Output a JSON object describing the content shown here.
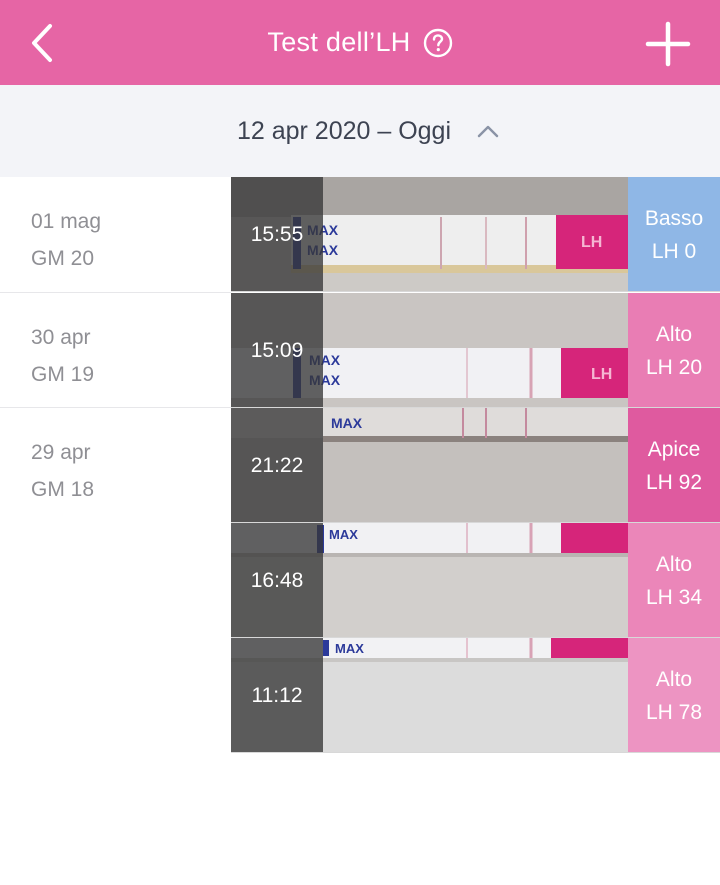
{
  "header": {
    "title": "Test dell’LH",
    "back_icon": "chevron-left-icon",
    "help_icon": "question-circle-icon",
    "add_icon": "plus-icon",
    "color": "#e665a5"
  },
  "range": {
    "label": "12 apr 2020 – Oggi",
    "icon": "chevron-up-icon"
  },
  "days": [
    {
      "date": "01 mag",
      "cycle_day": "GM 20"
    },
    {
      "date": "30 apr",
      "cycle_day": "GM 19"
    },
    {
      "date": "29 apr",
      "cycle_day": "GM 18"
    }
  ],
  "tests": [
    {
      "time": "15:55",
      "level": "Basso",
      "value": "LH 0",
      "color": "#8fb7e6"
    },
    {
      "time": "15:09",
      "level": "Alto",
      "value": "LH 20",
      "color": "#e97db4"
    },
    {
      "time": "21:22",
      "level": "Apice",
      "value": "LH 92",
      "color": "#df5a9f"
    },
    {
      "time": "16:48",
      "level": "Alto",
      "value": "LH 34",
      "color": "#eb86b9"
    },
    {
      "time": "11:12",
      "level": "Alto",
      "value": "LH 78",
      "color": "#ed94c2"
    }
  ],
  "strip": {
    "marker_text": "MAX",
    "brand_text": "LH"
  }
}
